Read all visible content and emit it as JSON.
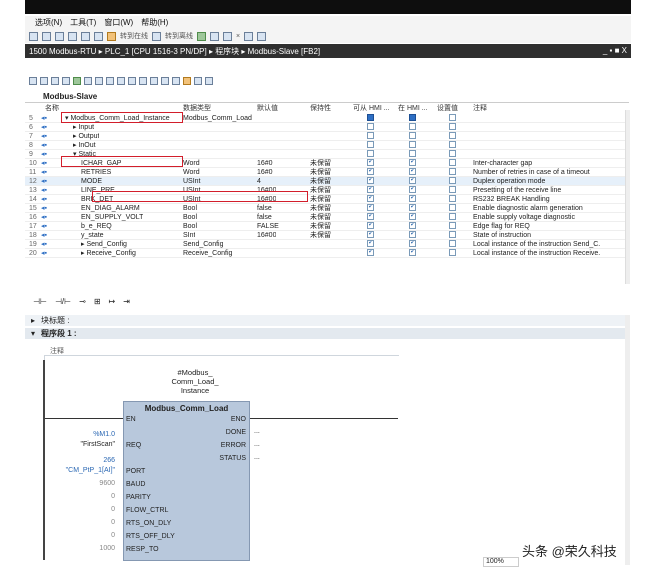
{
  "menu": [
    "选项(N)",
    "工具(T)",
    "窗口(W)",
    "帮助(H)"
  ],
  "toolbar": {
    "go_online": "转到在线",
    "go_offline": "转到离线"
  },
  "title": "1500 Modbus-RTU ▸ PLC_1 [CPU 1516-3 PN/DP] ▸ 程序块 ▸ Modbus-Slave [FB2]",
  "window_controls": "_ ▪ ■ X",
  "block_name": "Modbus-Slave",
  "grid": {
    "headers": [
      "名称",
      "数据类型",
      "默认值",
      "保持性",
      "可从 HMI ...",
      "在 HMI ...",
      "设置值",
      "注释"
    ],
    "rows": [
      {
        "n": "5",
        "name": "▾ Modbus_Comm_Load_Instance",
        "type": "Modbus_Comm_Load",
        "def": "",
        "keep": "",
        "hmi1": "blue",
        "hmi2": "blue",
        "set": "",
        "comment": "",
        "indent": 0
      },
      {
        "n": "6",
        "name": "▸ Input",
        "type": "",
        "def": "",
        "keep": "",
        "hmi1": "",
        "hmi2": "",
        "set": "",
        "comment": "",
        "indent": 1
      },
      {
        "n": "7",
        "name": "▸ Output",
        "type": "",
        "def": "",
        "keep": "",
        "hmi1": "",
        "hmi2": "",
        "set": "",
        "comment": "",
        "indent": 1
      },
      {
        "n": "8",
        "name": "▸ InOut",
        "type": "",
        "def": "",
        "keep": "",
        "hmi1": "",
        "hmi2": "",
        "set": "",
        "comment": "",
        "indent": 1
      },
      {
        "n": "9",
        "name": "▾ Static",
        "type": "",
        "def": "",
        "keep": "",
        "hmi1": "",
        "hmi2": "",
        "set": "",
        "comment": "",
        "indent": 1
      },
      {
        "n": "10",
        "name": "ICHAR_GAP",
        "type": "Word",
        "def": "16#0",
        "keep": "未保留",
        "hmi1": "on",
        "hmi2": "on",
        "set": "",
        "comment": "Inter-character gap",
        "indent": 2
      },
      {
        "n": "11",
        "name": "RETRIES",
        "type": "Word",
        "def": "16#0",
        "keep": "未保留",
        "hmi1": "on",
        "hmi2": "on",
        "set": "",
        "comment": "Number of retries in case of a timeout",
        "indent": 2
      },
      {
        "n": "12",
        "name": "MODE",
        "type": "USInt",
        "def": "4",
        "keep": "未保留",
        "hmi1": "on",
        "hmi2": "on",
        "set": "",
        "comment": "Duplex operation mode",
        "indent": 2
      },
      {
        "n": "13",
        "name": "LINE_PRE",
        "type": "USInt",
        "def": "16#00",
        "keep": "未保留",
        "hmi1": "on",
        "hmi2": "on",
        "set": "",
        "comment": "Presetting of the receive line",
        "indent": 2
      },
      {
        "n": "14",
        "name": "BRK_DET",
        "type": "USInt",
        "def": "16#00",
        "keep": "未保留",
        "hmi1": "on",
        "hmi2": "on",
        "set": "",
        "comment": "RS232 BREAK Handling",
        "indent": 2
      },
      {
        "n": "15",
        "name": "EN_DIAG_ALARM",
        "type": "Bool",
        "def": "false",
        "keep": "未保留",
        "hmi1": "on",
        "hmi2": "on",
        "set": "",
        "comment": "Enable diagnostic alarm generation",
        "indent": 2
      },
      {
        "n": "16",
        "name": "EN_SUPPLY_VOLT",
        "type": "Bool",
        "def": "false",
        "keep": "未保留",
        "hmi1": "on",
        "hmi2": "on",
        "set": "",
        "comment": "Enable supply voltage diagnostic",
        "indent": 2
      },
      {
        "n": "17",
        "name": "b_e_REQ",
        "type": "Bool",
        "def": "FALSE",
        "keep": "未保留",
        "hmi1": "on",
        "hmi2": "on",
        "set": "",
        "comment": "Edge flag for REQ",
        "indent": 2
      },
      {
        "n": "18",
        "name": "y_state",
        "type": "SInt",
        "def": "16#00",
        "keep": "未保留",
        "hmi1": "on",
        "hmi2": "on",
        "set": "",
        "comment": "State of instruction",
        "indent": 2
      },
      {
        "n": "19",
        "name": "▸ Send_Config",
        "type": "Send_Config",
        "def": "",
        "keep": "",
        "hmi1": "on",
        "hmi2": "on",
        "set": "",
        "comment": "Local instance of the instruction Send_C.",
        "indent": 2
      },
      {
        "n": "20",
        "name": "▸ Receive_Config",
        "type": "Receive_Config",
        "def": "",
        "keep": "",
        "hmi1": "on",
        "hmi2": "on",
        "set": "",
        "comment": "Local instance of the instruction Receive.",
        "indent": 2
      }
    ]
  },
  "block_title": "块标题 :",
  "network": {
    "label": "程序段 1 :",
    "comment": "注释"
  },
  "instance": {
    "line1": "#Modbus_",
    "line2": "Comm_Load_",
    "line3": "Instance"
  },
  "fb": {
    "name": "Modbus_Comm_Load",
    "en": "EN",
    "eno": "ENO",
    "outputs": [
      "DONE",
      "ERROR",
      "STATUS"
    ],
    "inputs": [
      "REQ",
      "PORT",
      "BAUD",
      "PARITY",
      "FLOW_CTRL",
      "RTS_ON_DLY",
      "RTS_OFF_DLY",
      "RESP_TO"
    ],
    "in_values": {
      "req_addr": "%M1.0",
      "req_sym": "\"FirstScan\"",
      "port_num": "266",
      "port_sym": "\"CM_PtP_1[AI]\"",
      "baud": "9600",
      "parity": "0",
      "flow": "0",
      "rts_on": "0",
      "rts_off": "0",
      "resp": "1000"
    },
    "out_values": [
      "...",
      "...",
      "..."
    ]
  },
  "zoom": "100%",
  "watermark": "头条 @荣久科技"
}
